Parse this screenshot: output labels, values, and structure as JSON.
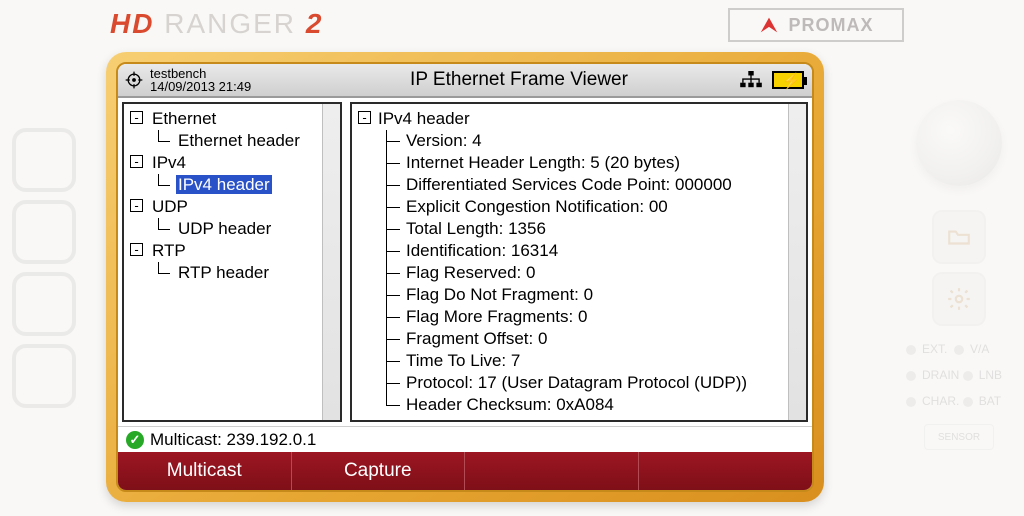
{
  "branding": {
    "hd": "HD",
    "ranger": " RANGER ",
    "two": "2",
    "promax": "PROMAX"
  },
  "titlebar": {
    "profile": "testbench",
    "datetime": "14/09/2013 21:49",
    "title": "IP Ethernet Frame Viewer"
  },
  "tree": {
    "ethernet": "Ethernet",
    "ethernet_header": "Ethernet header",
    "ipv4": "IPv4",
    "ipv4_header": "IPv4 header",
    "udp": "UDP",
    "udp_header": "UDP header",
    "rtp": "RTP",
    "rtp_header": "RTP header"
  },
  "detail": {
    "heading": "IPv4 header",
    "fields": [
      "Version: 4",
      "Internet Header Length: 5 (20 bytes)",
      "Differentiated Services Code Point: 000000",
      "Explicit Congestion Notification: 00",
      "Total Length: 1356",
      "Identification: 16314",
      "Flag Reserved: 0",
      "Flag Do Not Fragment: 0",
      "Flag More Fragments: 0",
      "Fragment Offset: 0",
      "Time To Live: 7",
      "Protocol: 17 (User Datagram Protocol (UDP))",
      "Header Checksum: 0xA084"
    ]
  },
  "status": {
    "text": "Multicast: 239.192.0.1"
  },
  "tabs": {
    "multicast": "Multicast",
    "capture": "Capture"
  },
  "side_labels": {
    "ext": "EXT.",
    "va": "V/A",
    "drain": "DRAIN",
    "lnb": "LNB",
    "char": "CHAR.",
    "bat": "BAT",
    "sensor": "SENSOR"
  }
}
